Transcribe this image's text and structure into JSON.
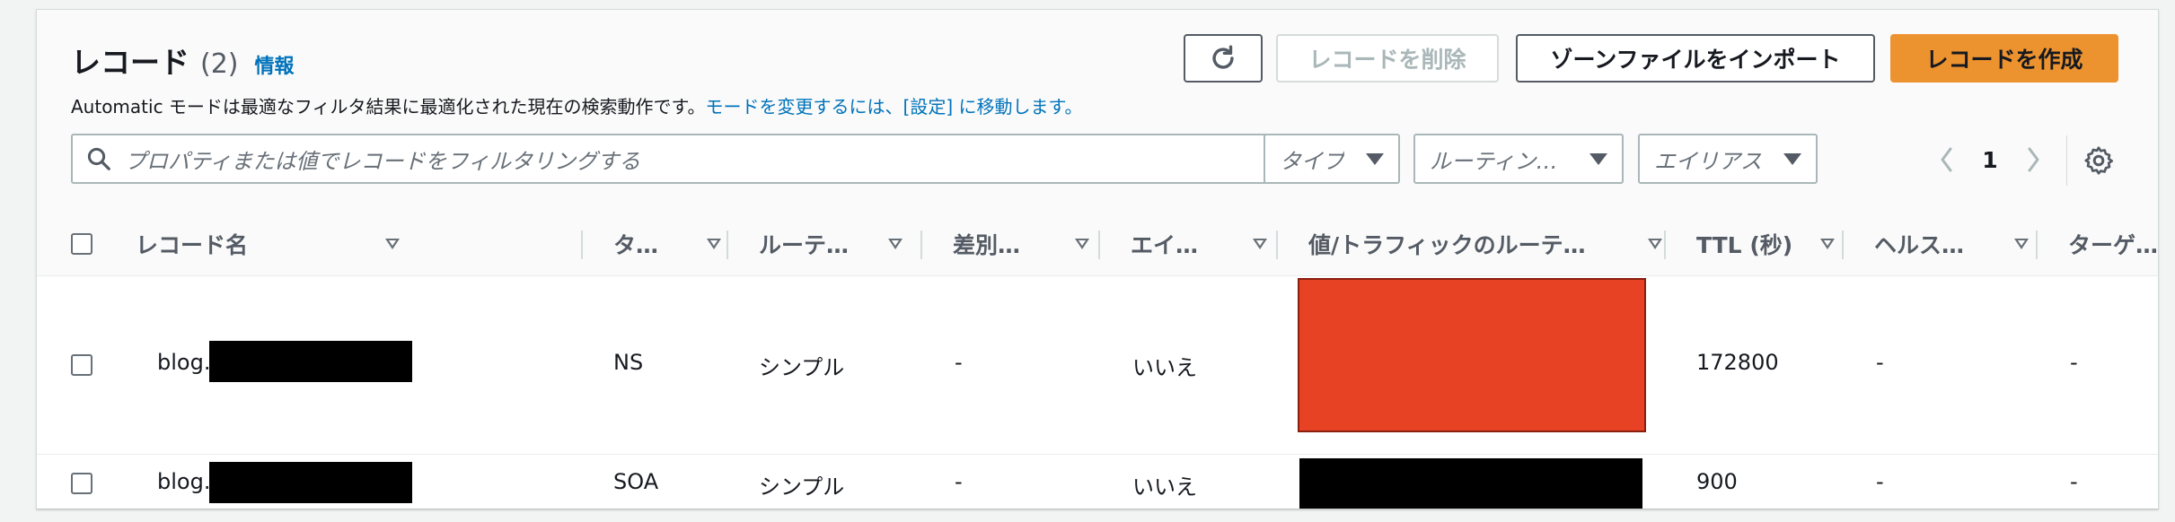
{
  "header": {
    "title": "レコード",
    "count": "(2)",
    "info_link": "情報",
    "subtitle_text": "Automatic モードは最適なフィルタ結果に最適化された現在の検索動作です。",
    "subtitle_link": "モードを変更するには、[設定] に移動します。"
  },
  "toolbar": {
    "refresh_icon": "refresh-icon",
    "delete_label": "レコードを削除",
    "import_label": "ゾーンファイルをインポート",
    "create_label": "レコードを作成"
  },
  "filters": {
    "search_placeholder": "プロパティまたは値でレコードをフィルタリングする",
    "type_label": "タイプ",
    "routing_label": "ルーティン…",
    "alias_label": "エイリアス"
  },
  "pagination": {
    "current_page": "1"
  },
  "table": {
    "columns": [
      "レコード名",
      "タ…",
      "ルーテ…",
      "差別…",
      "エイ…",
      "値/トラフィックのルーテ…",
      "TTL (秒)",
      "ヘルス…",
      "ターゲ…"
    ],
    "rows": [
      {
        "name": "blog.",
        "type": "NS",
        "routing": "シンプル",
        "differentiator": "-",
        "alias": "いいえ",
        "ttl": "172800",
        "health": "-",
        "target": "-"
      },
      {
        "name": "blog.",
        "type": "SOA",
        "routing": "シンプル",
        "differentiator": "-",
        "alias": "いいえ",
        "ttl": "900",
        "health": "-",
        "target": "-"
      }
    ]
  },
  "colors": {
    "accent": "#ec9330",
    "link": "#0073bb",
    "redaction_red": "#e84225"
  }
}
